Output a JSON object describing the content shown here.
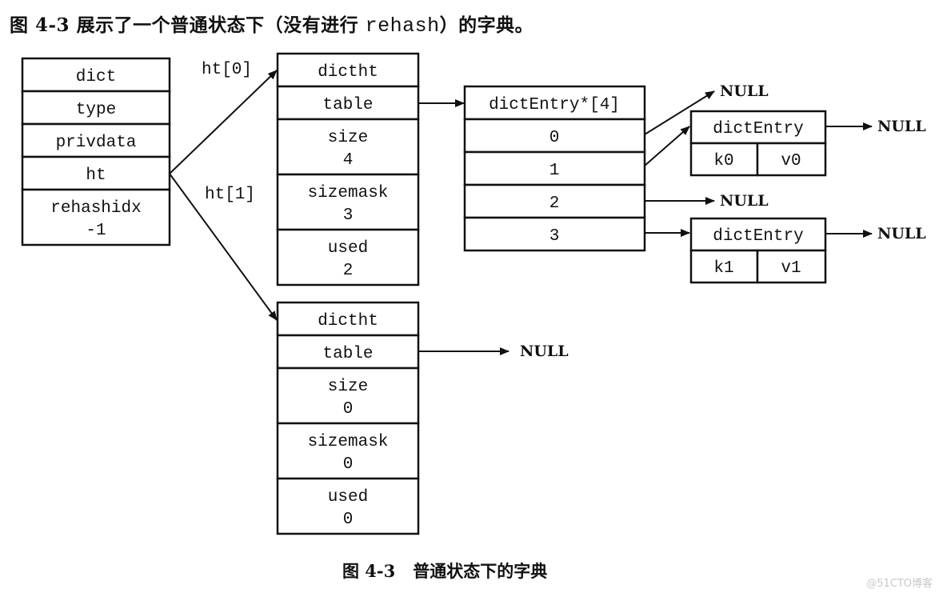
{
  "heading": {
    "prefix": "图 4-3 展示了一个普通状态下（没有进行 ",
    "code": "rehash",
    "suffix": "）的字典。"
  },
  "dict": {
    "fields": [
      "dict",
      "type",
      "privdata",
      "ht"
    ],
    "rehashidx": {
      "name": "rehashidx",
      "value": "-1"
    }
  },
  "labels": {
    "ht0": "ht[0]",
    "ht1": "ht[1]"
  },
  "ht0": {
    "title": "dictht",
    "table": "table",
    "size": {
      "name": "size",
      "value": "4"
    },
    "sizemask": {
      "name": "sizemask",
      "value": "3"
    },
    "used": {
      "name": "used",
      "value": "2"
    }
  },
  "ht1": {
    "title": "dictht",
    "table": "table",
    "table_target": "NULL",
    "size": {
      "name": "size",
      "value": "0"
    },
    "sizemask": {
      "name": "sizemask",
      "value": "0"
    },
    "used": {
      "name": "used",
      "value": "0"
    }
  },
  "bucket_array": {
    "title": "dictEntry*[4]",
    "buckets": [
      "0",
      "1",
      "2",
      "3"
    ]
  },
  "entries": [
    {
      "title": "dictEntry",
      "key": "k0",
      "value": "v0",
      "next": "NULL"
    },
    {
      "title": "dictEntry",
      "key": "k1",
      "value": "v1",
      "next": "NULL"
    }
  ],
  "null_labels": {
    "bucket0": "NULL",
    "bucket2": "NULL"
  },
  "caption": {
    "number": "图 4-3",
    "text": "普通状态下的字典"
  },
  "watermark": "@51CTO博客"
}
